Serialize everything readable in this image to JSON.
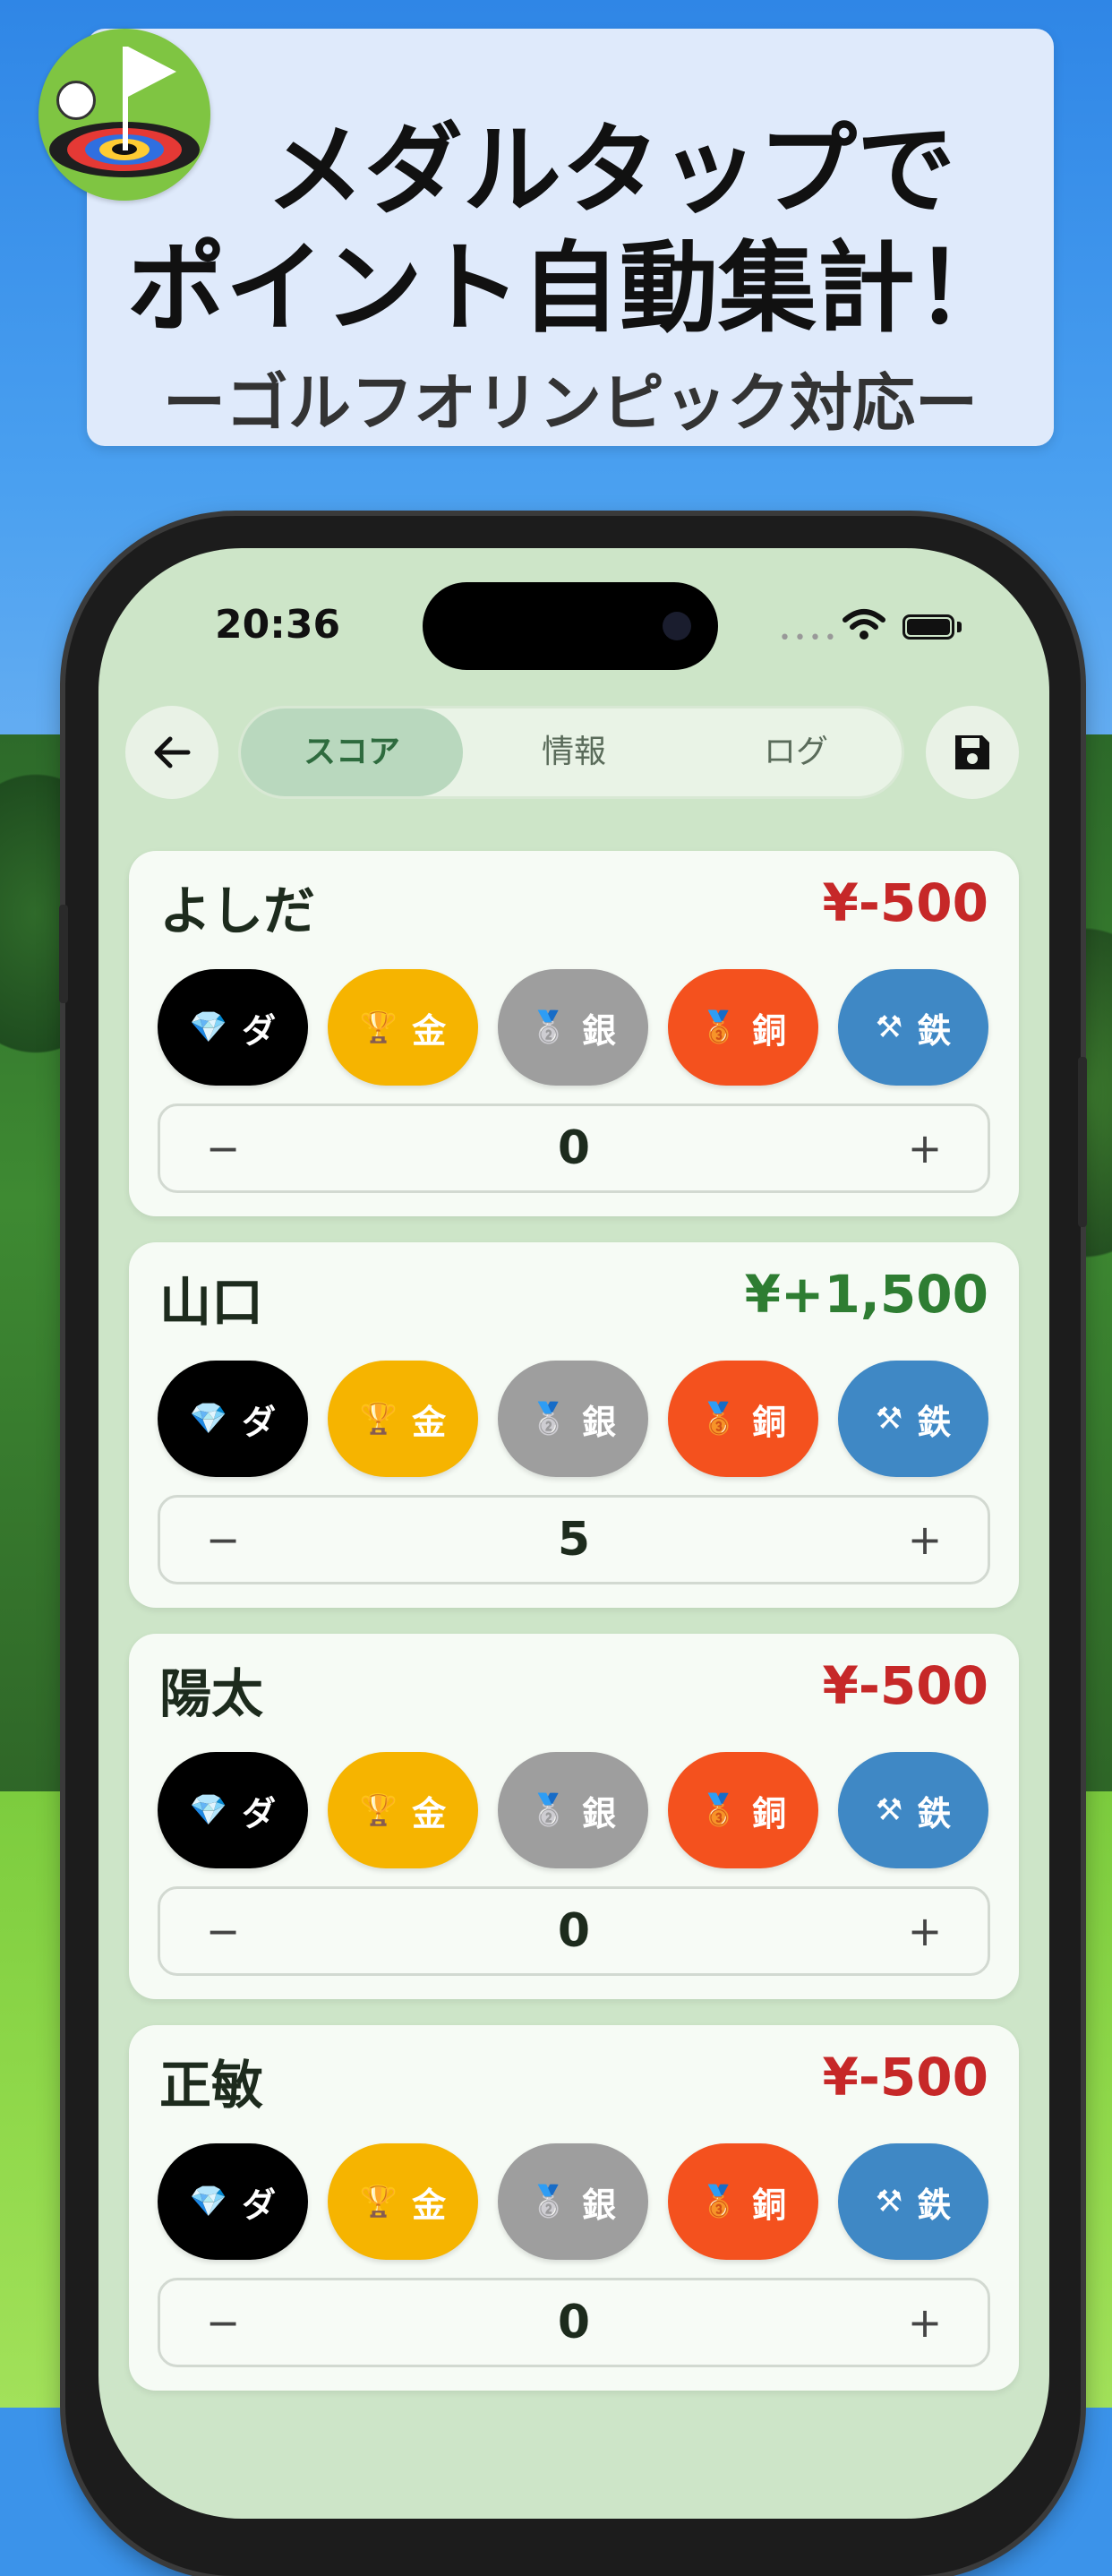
{
  "banner": {
    "line1": "メダルタップで",
    "line2": "ポイント自動集計！",
    "subtitle": "ーゴルフオリンピック対応ー"
  },
  "status": {
    "time": "20:36"
  },
  "nav": {
    "back_icon": "arrow-left-icon",
    "save_icon": "floppy-disk-icon",
    "tabs": [
      {
        "label": "スコア",
        "active": true
      },
      {
        "label": "情報",
        "active": false
      },
      {
        "label": "ログ",
        "active": false
      }
    ]
  },
  "medal_buttons": [
    {
      "icon": "💎",
      "label": "ダ",
      "color": "#000000"
    },
    {
      "icon": "🏆",
      "label": "金",
      "color": "#f6b400"
    },
    {
      "icon": "🥈",
      "label": "銀",
      "color": "#9e9e9e"
    },
    {
      "icon": "🥉",
      "label": "銅",
      "color": "#f4511e"
    },
    {
      "icon": "⚒",
      "label": "鉄",
      "color": "#3f88c5"
    }
  ],
  "colors": {
    "negative": "#c62828",
    "positive": "#2e7d32"
  },
  "players": [
    {
      "name": "よしだ",
      "money": "¥-500",
      "sign": "negative",
      "count": "0",
      "minus": "−",
      "plus": "+"
    },
    {
      "name": "山口",
      "money": "¥+1,500",
      "sign": "positive",
      "count": "5",
      "minus": "−",
      "plus": "+"
    },
    {
      "name": "陽太",
      "money": "¥-500",
      "sign": "negative",
      "count": "0",
      "minus": "−",
      "plus": "+"
    },
    {
      "name": "正敏",
      "money": "¥-500",
      "sign": "negative",
      "count": "0",
      "minus": "−",
      "plus": "+"
    }
  ]
}
